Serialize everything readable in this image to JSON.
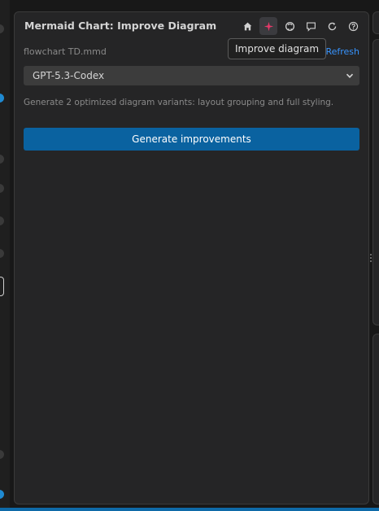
{
  "panel": {
    "title": "Mermaid Chart: Improve Diagram",
    "toolbar": {
      "icons": [
        "home-icon",
        "sparkle-icon",
        "github-icon",
        "feedback-icon",
        "refresh-icon",
        "help-icon"
      ],
      "active_icon": "sparkle-icon"
    },
    "tooltip": "Improve diagram",
    "file_name": "flowchart TD.mmd",
    "refresh_label": "Refresh",
    "model_select": {
      "value": "GPT-5.3-Codex"
    },
    "description": "Generate 2 optimized diagram variants: layout grouping and full styling.",
    "primary_button": "Generate improvements"
  },
  "colors": {
    "accent": "#0a62a0",
    "link": "#3794ff",
    "active_icon": "#e8396a",
    "background": "#181818",
    "panel": "#252526"
  }
}
